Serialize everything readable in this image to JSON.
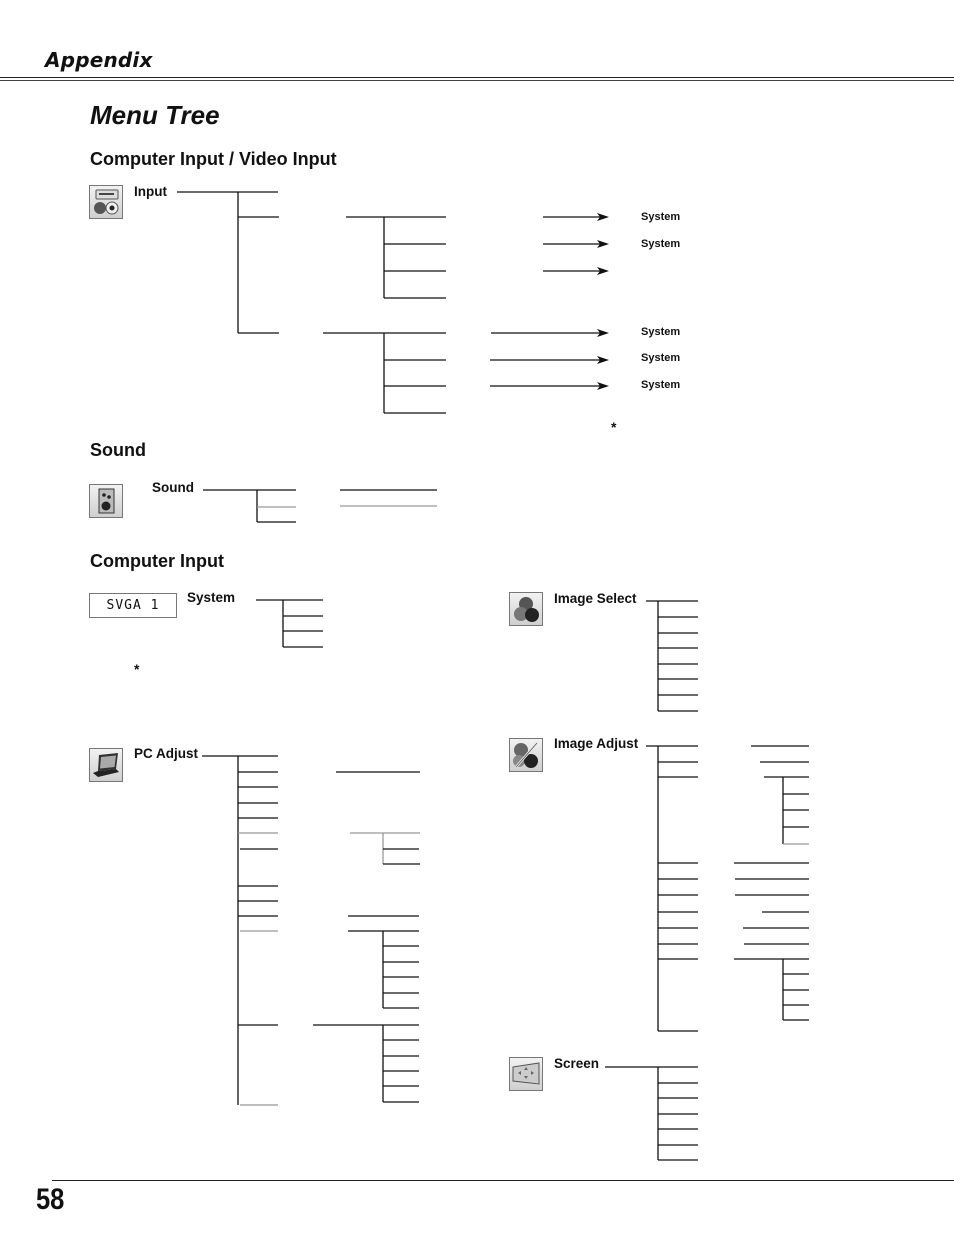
{
  "header": {
    "section": "Appendix"
  },
  "page_title": "Menu Tree",
  "sections": {
    "computer_video_input": {
      "heading": "Computer Input / Video Input",
      "root_label": "Input",
      "icon": "input-connector-icon",
      "arrow_targets": [
        "System",
        "System",
        "System",
        "System",
        "System"
      ],
      "footnote": "*"
    },
    "sound": {
      "heading": "Sound",
      "root_label": "Sound",
      "icon": "speaker-icon"
    },
    "computer_input": {
      "heading": "Computer Input",
      "system_box": "SVGA 1",
      "system_label": "System",
      "footnote": "*",
      "pc_adjust_label": "PC Adjust",
      "image_select_label": "Image Select",
      "image_adjust_label": "Image Adjust",
      "screen_label": "Screen"
    }
  },
  "footer": {
    "page_number": "58"
  }
}
